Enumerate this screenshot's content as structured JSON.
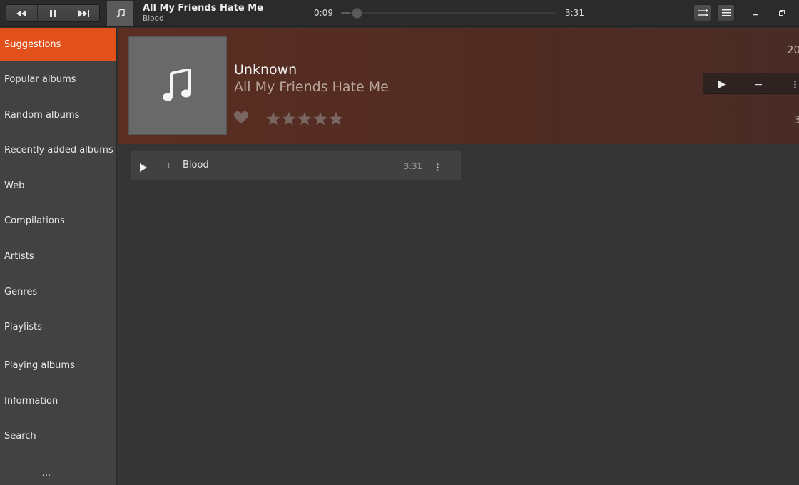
{
  "header": {
    "icons": {
      "previous": "previous-icon",
      "pause": "pause-icon",
      "next": "next-icon",
      "cover": "music-note-icon",
      "shuffle": "shuffle-icon",
      "menu": "hamburger-menu-icon",
      "minimize": "minimize-icon",
      "restore": "restore-icon"
    },
    "now_playing": {
      "title": "All My Friends Hate Me",
      "subtitle": "Blood"
    },
    "time_elapsed": "0:09",
    "time_total": "3:31",
    "progress_fraction": 0.043
  },
  "sidebar": {
    "items": [
      {
        "label": "Suggestions",
        "active": true
      },
      {
        "label": "Popular albums"
      },
      {
        "label": "Random albums"
      },
      {
        "label": "Recently added albums"
      },
      {
        "label": "Web"
      },
      {
        "label": "Compilations"
      },
      {
        "label": "Artists"
      },
      {
        "label": "Genres"
      },
      {
        "label": "Playlists"
      },
      {
        "label": "Playing albums"
      },
      {
        "label": "Information"
      },
      {
        "label": "Search"
      }
    ],
    "more_label": "..."
  },
  "album": {
    "artist": "Unknown",
    "title": "All My Friends Hate Me",
    "year": "20",
    "duration": "3",
    "rating": 0,
    "max_rating": 5,
    "icons": {
      "art": "music-note-icon",
      "loved": "heart-icon",
      "play": "play-icon",
      "remove": "minus-icon",
      "more": "more-vertical-icon"
    }
  },
  "tracks": [
    {
      "number": "1",
      "title": "Blood",
      "duration": "3:31"
    }
  ],
  "colors": {
    "accent": "#e2501c",
    "background": "#353535",
    "sidebar": "#424242",
    "banner": "#5b2e22"
  }
}
